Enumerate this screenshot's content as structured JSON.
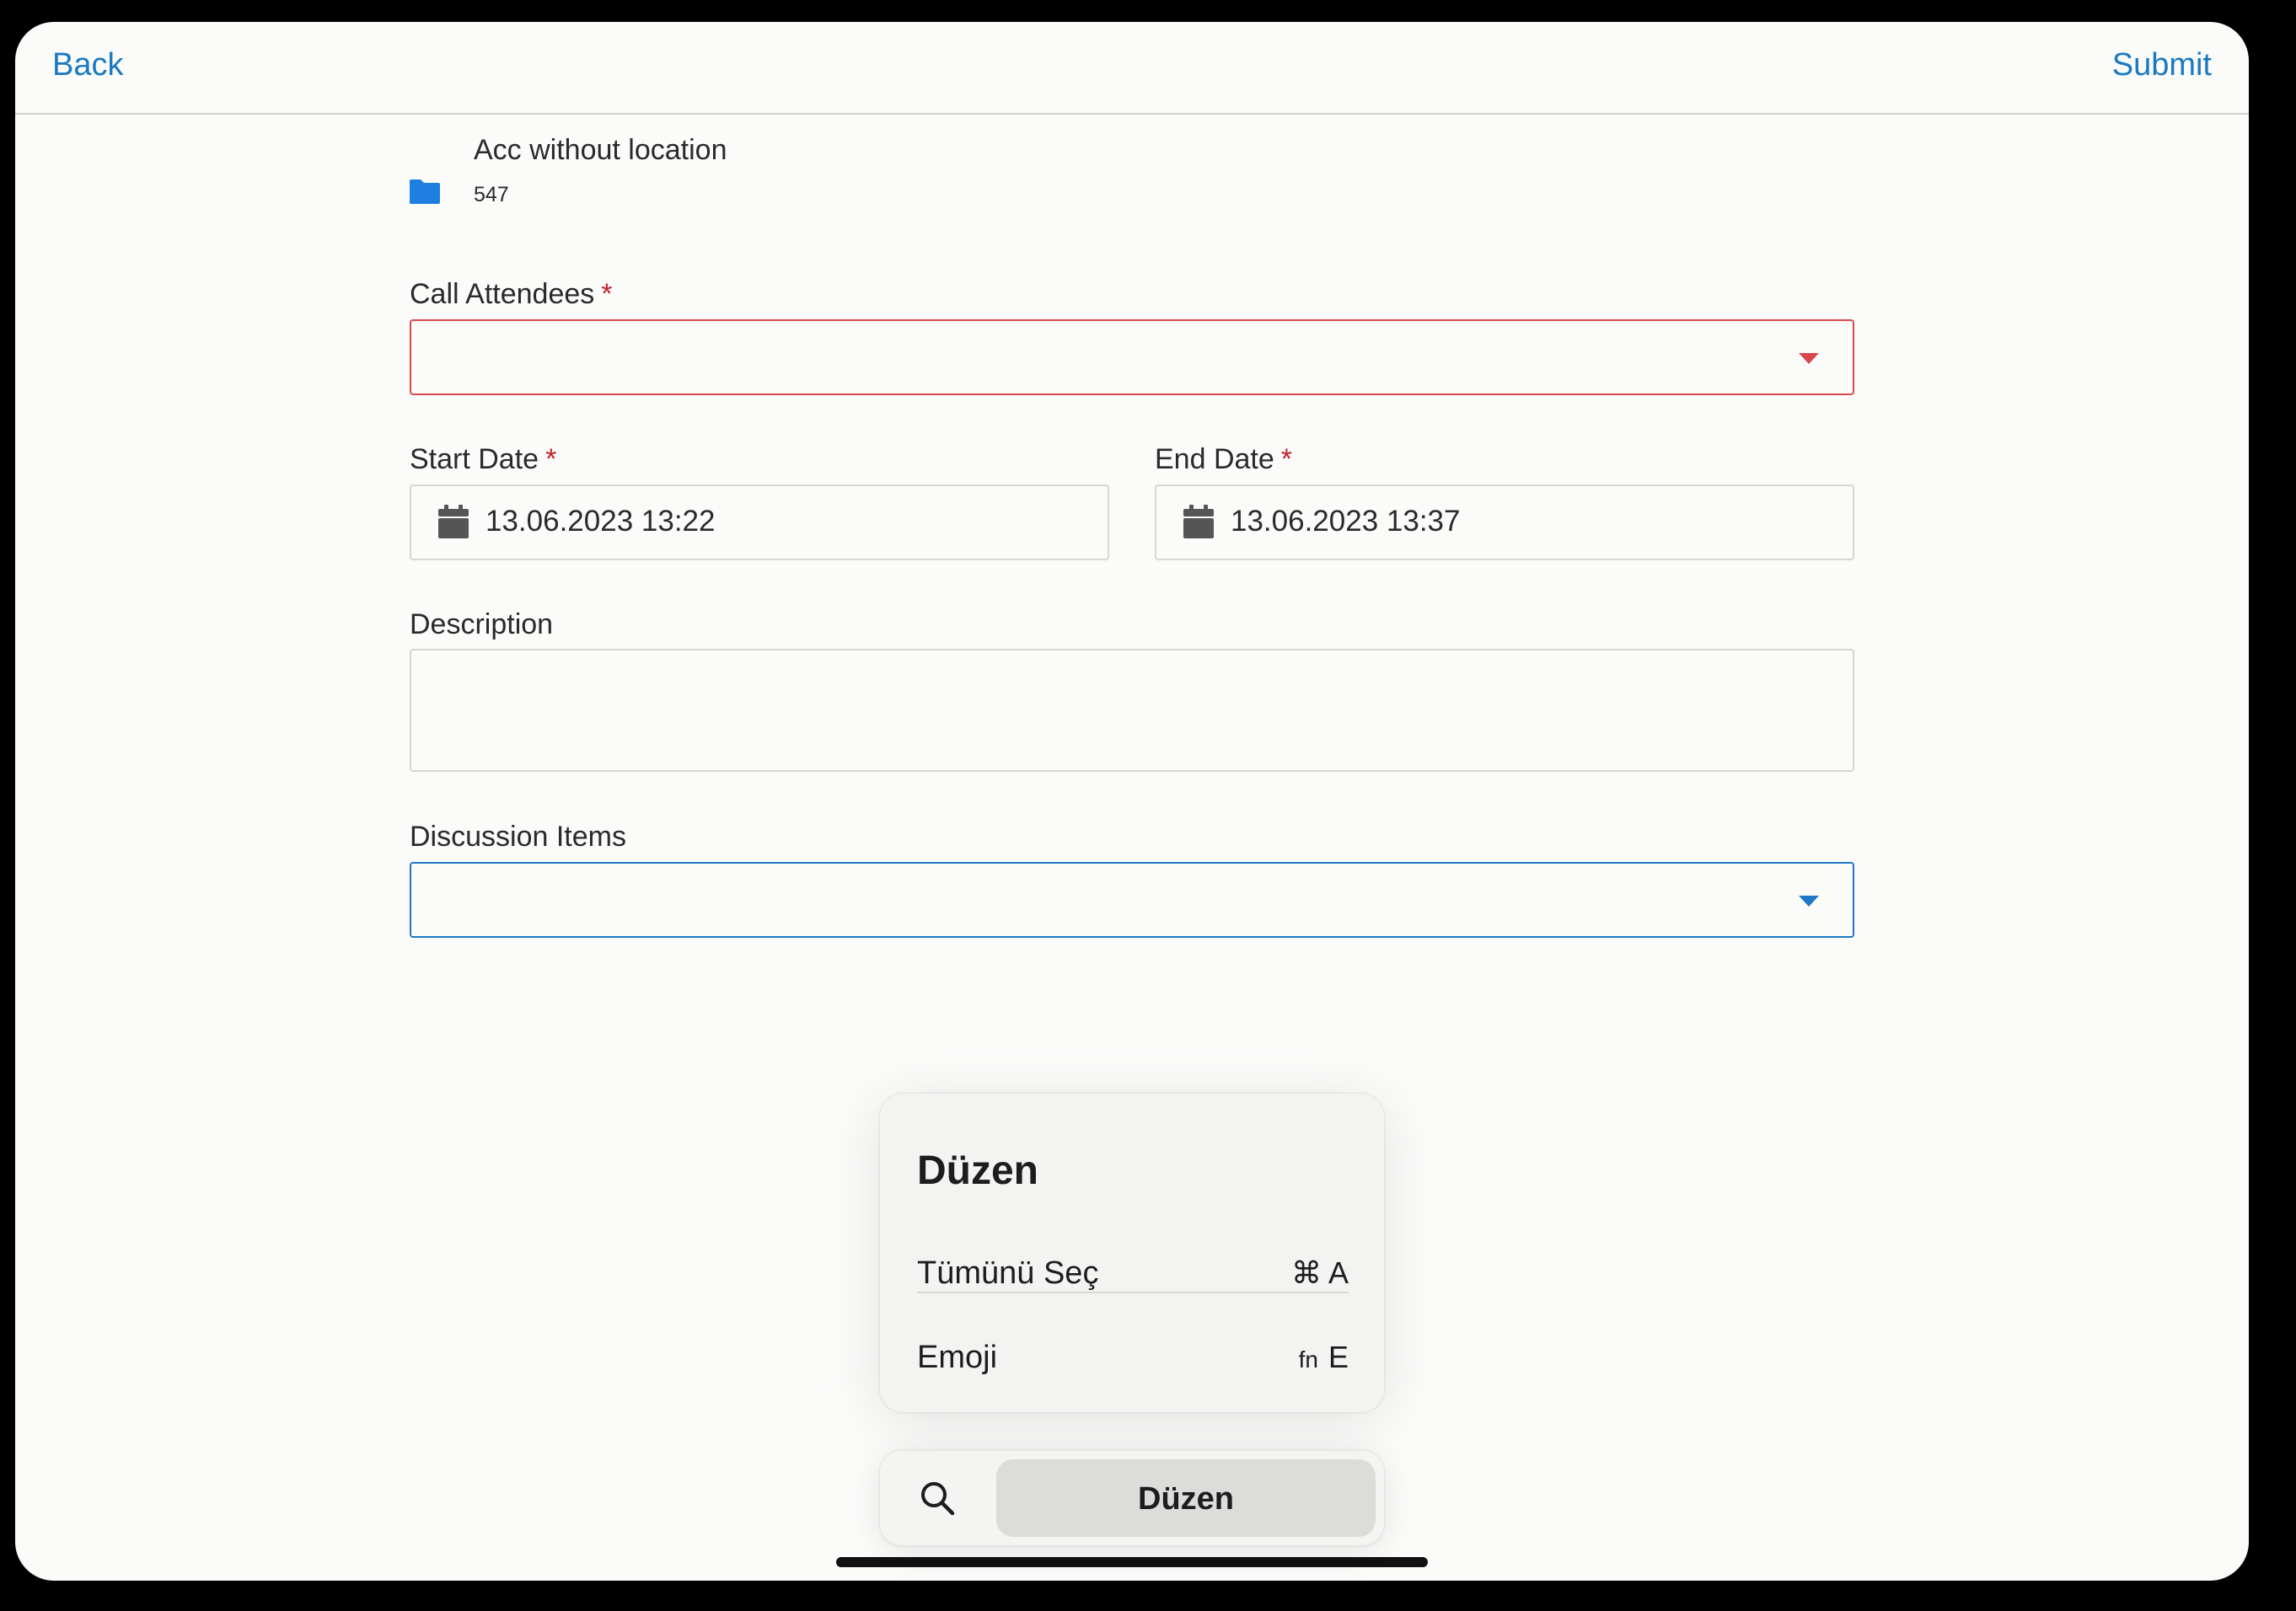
{
  "navbar": {
    "back_label": "Back",
    "submit_label": "Submit"
  },
  "account": {
    "name": "Acc without location",
    "code": "547"
  },
  "form": {
    "call_attendees": {
      "label": "Call Attendees",
      "required_mark": "*",
      "value": ""
    },
    "start_date": {
      "label": "Start Date",
      "required_mark": "*",
      "value": "13.06.2023 13:22"
    },
    "end_date": {
      "label": "End Date",
      "required_mark": "*",
      "value": "13.06.2023 13:37"
    },
    "description": {
      "label": "Description",
      "value": ""
    },
    "discussion_items": {
      "label": "Discussion Items",
      "value": ""
    }
  },
  "edit_menu": {
    "title": "Düzen",
    "items": [
      {
        "label": "Tümünü Seç",
        "shortcut_mod": "⌘",
        "shortcut_key": "A"
      },
      {
        "label": "Emoji",
        "shortcut_mod": "fn",
        "shortcut_key": "E"
      }
    ]
  },
  "toolbar": {
    "edit_label": "Düzen"
  },
  "colors": {
    "link": "#1a79c2",
    "error": "#d9484e",
    "focus": "#1e78c8",
    "required": "#c7202a",
    "folder": "#1e7fe0"
  },
  "icons": {
    "account": "folder-icon",
    "date": "calendar-icon",
    "dropdown": "caret-down-icon",
    "search": "search-icon"
  }
}
